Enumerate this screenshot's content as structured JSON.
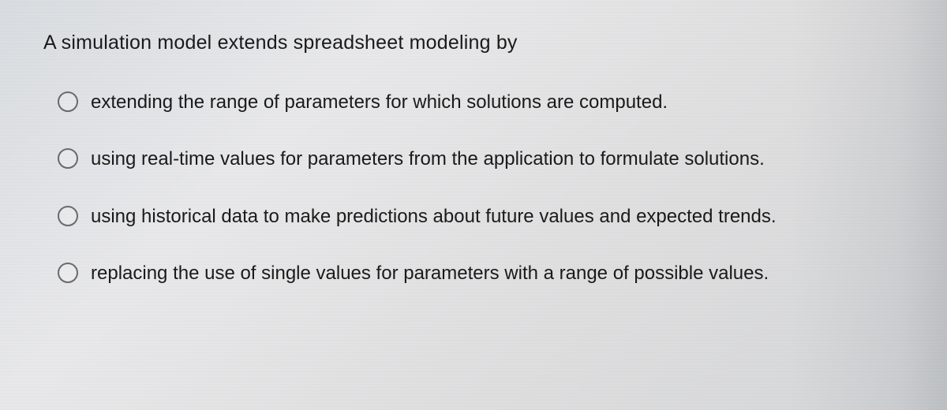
{
  "question": "A simulation model extends spreadsheet modeling by",
  "options": [
    {
      "label": "extending the range of parameters for which solutions are computed."
    },
    {
      "label": "using real-time values for parameters from the application to formulate solutions."
    },
    {
      "label": "using historical data to make predictions about future values and expected trends."
    },
    {
      "label": "replacing the use of single values for parameters with a range of possible values."
    }
  ]
}
